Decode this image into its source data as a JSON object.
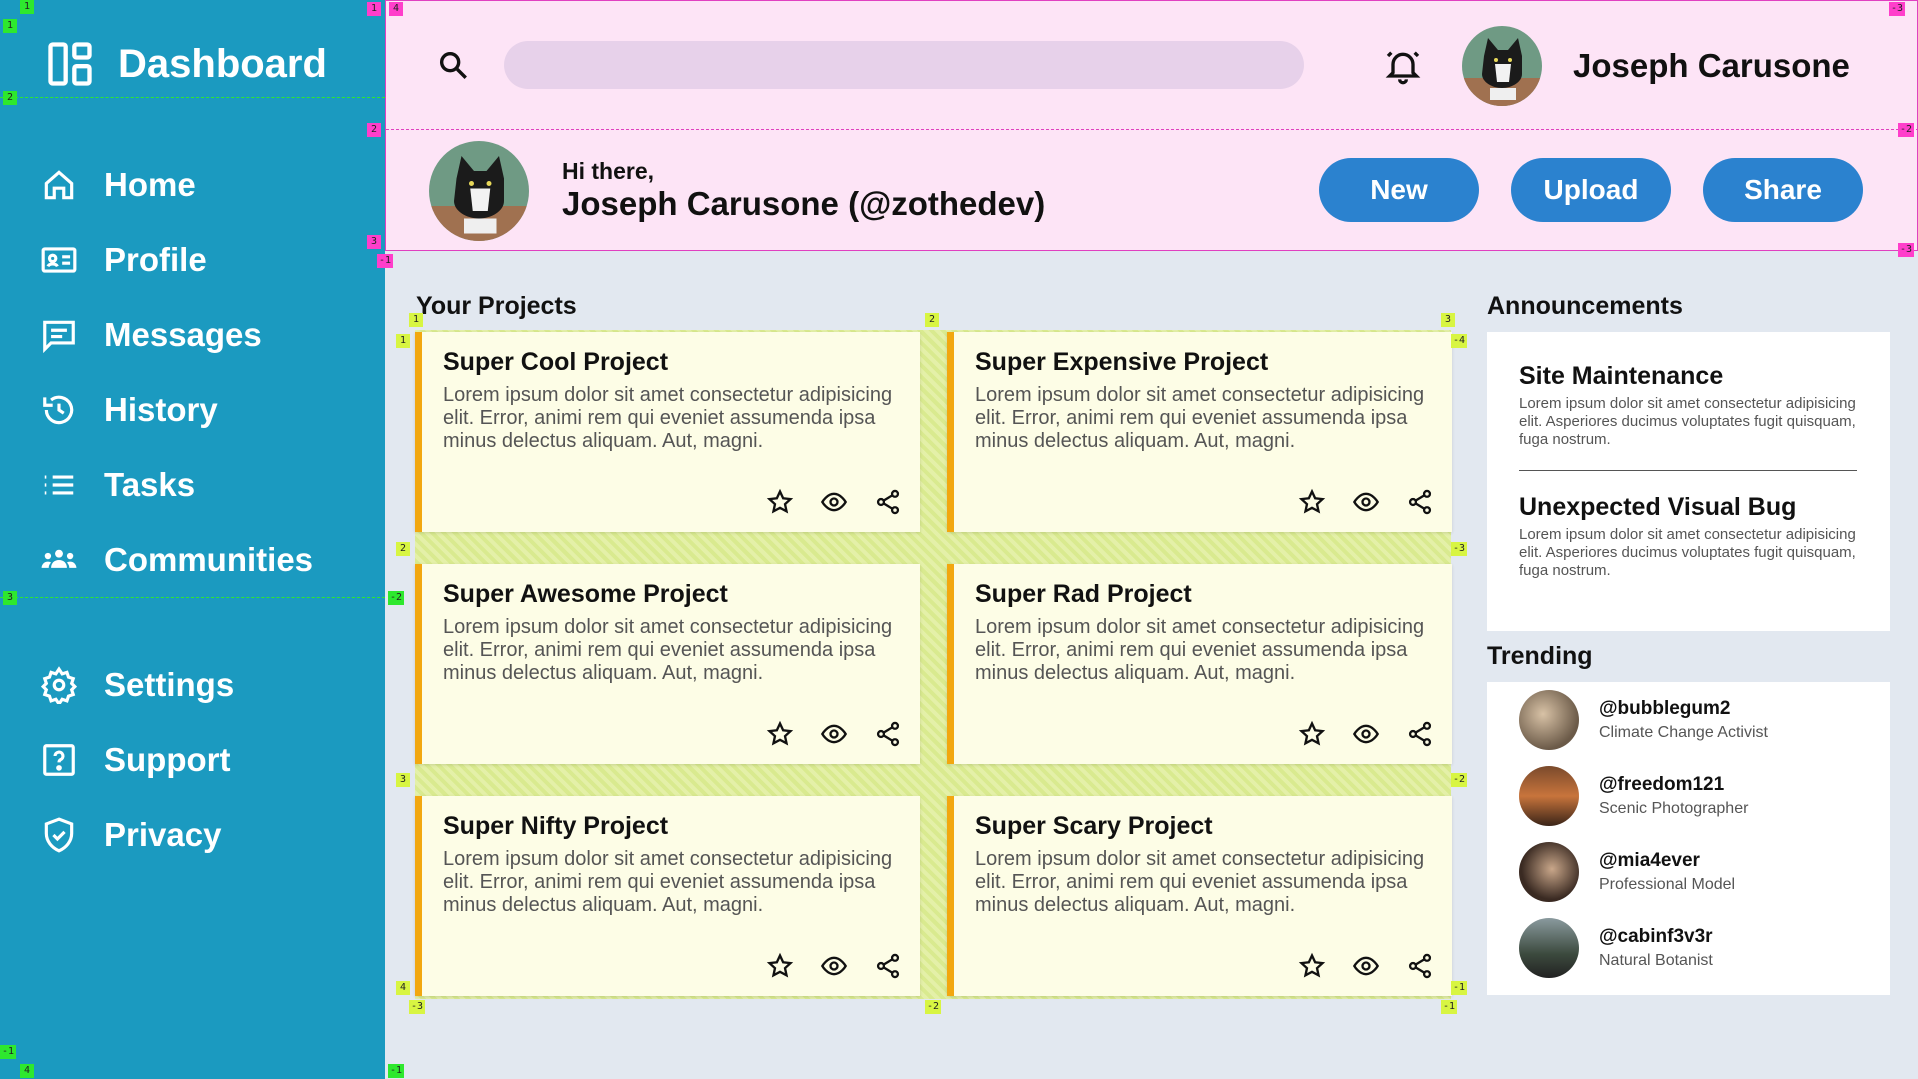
{
  "sidebar": {
    "title": "Dashboard",
    "nav_top": [
      {
        "label": "Home",
        "icon": "home-icon"
      },
      {
        "label": "Profile",
        "icon": "profile-card-icon"
      },
      {
        "label": "Messages",
        "icon": "message-icon"
      },
      {
        "label": "History",
        "icon": "history-icon"
      },
      {
        "label": "Tasks",
        "icon": "list-icon"
      },
      {
        "label": "Communities",
        "icon": "people-icon"
      }
    ],
    "nav_bottom": [
      {
        "label": "Settings",
        "icon": "gear-icon"
      },
      {
        "label": "Support",
        "icon": "help-icon"
      },
      {
        "label": "Privacy",
        "icon": "shield-icon"
      }
    ]
  },
  "header": {
    "search_placeholder": "",
    "user_name": "Joseph Carusone",
    "greeting": "Hi there,",
    "greeting_name": "Joseph Carusone (@zothedev)",
    "buttons": {
      "new": "New",
      "upload": "Upload",
      "share": "Share"
    }
  },
  "projects": {
    "title": "Your Projects",
    "items": [
      {
        "title": "Super Cool Project",
        "body": "Lorem ipsum dolor sit amet consectetur adipisicing elit. Error, animi rem qui eveniet assumenda ipsa minus delectus aliquam. Aut, magni."
      },
      {
        "title": "Super Expensive Project",
        "body": "Lorem ipsum dolor sit amet consectetur adipisicing elit. Error, animi rem qui eveniet assumenda ipsa minus delectus aliquam. Aut, magni."
      },
      {
        "title": "Super Awesome Project",
        "body": "Lorem ipsum dolor sit amet consectetur adipisicing elit. Error, animi rem qui eveniet assumenda ipsa minus delectus aliquam. Aut, magni."
      },
      {
        "title": "Super Rad Project",
        "body": "Lorem ipsum dolor sit amet consectetur adipisicing elit. Error, animi rem qui eveniet assumenda ipsa minus delectus aliquam. Aut, magni."
      },
      {
        "title": "Super Nifty Project",
        "body": "Lorem ipsum dolor sit amet consectetur adipisicing elit. Error, animi rem qui eveniet assumenda ipsa minus delectus aliquam. Aut, magni."
      },
      {
        "title": "Super Scary Project",
        "body": "Lorem ipsum dolor sit amet consectetur adipisicing elit. Error, animi rem qui eveniet assumenda ipsa minus delectus aliquam. Aut, magni."
      }
    ]
  },
  "announcements": {
    "title": "Announcements",
    "items": [
      {
        "title": "Site Maintenance",
        "body": "Lorem ipsum dolor sit amet consectetur adipisicing elit. Asperiores ducimus voluptates fugit quisquam, fuga nostrum."
      },
      {
        "title": "Unexpected Visual Bug",
        "body": "Lorem ipsum dolor sit amet consectetur adipisicing elit. Asperiores ducimus voluptates fugit quisquam, fuga nostrum."
      }
    ]
  },
  "trending": {
    "title": "Trending",
    "items": [
      {
        "handle": "@bubblegum2",
        "role": "Climate Change Activist"
      },
      {
        "handle": "@freedom121",
        "role": "Scenic Photographer"
      },
      {
        "handle": "@mia4ever",
        "role": "Professional Model"
      },
      {
        "handle": "@cabinf3v3r",
        "role": "Natural Botanist"
      }
    ]
  },
  "grid_tags": {
    "sidebar": [
      "1",
      "2",
      "3",
      "-1",
      "1",
      "4",
      "-3",
      "-2",
      "-1"
    ],
    "header": [
      "1",
      "4",
      "-3",
      "2",
      "-2",
      "3",
      "-1",
      "-3",
      "-2",
      "-1"
    ],
    "projects": [
      "1",
      "2",
      "3",
      "-4",
      "1",
      "2",
      "-3",
      "3",
      "-2",
      "4",
      "-1",
      "-3",
      "-2",
      "-1"
    ]
  },
  "colors": {
    "sidebar": "#1b9ac0",
    "header": "#fde4f6",
    "button": "#2b82cf",
    "card": "#fdfde6",
    "card_accent": "#f2a70f",
    "page": "#e2e8f0"
  }
}
